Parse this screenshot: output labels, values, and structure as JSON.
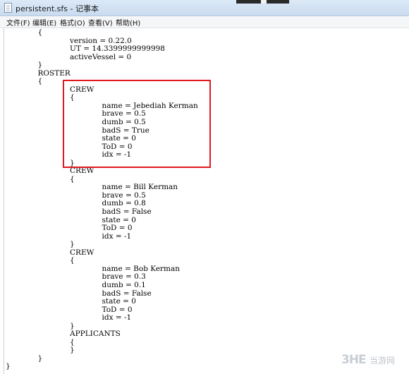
{
  "window": {
    "title": "persistent.sfs - 记事本",
    "icon": "notepad-file-icon"
  },
  "menu": {
    "items": [
      {
        "label": "文件(F)"
      },
      {
        "label": "编辑(E)"
      },
      {
        "label": "格式(O)"
      },
      {
        "label": "查看(V)"
      },
      {
        "label": "帮助(H)"
      }
    ]
  },
  "editor": {
    "lines": [
      "\t{",
      "\t\tversion = 0.22.0",
      "\t\tUT = 14.3399999999998",
      "\t\tactiveVessel = 0",
      "\t}",
      "\tROSTER",
      "\t{",
      "\t\tCREW",
      "\t\t{",
      "\t\t\tname = Jebediah Kerman",
      "\t\t\tbrave = 0.5",
      "\t\t\tdumb = 0.5",
      "\t\t\tbadS = True",
      "\t\t\tstate = 0",
      "\t\t\tToD = 0",
      "\t\t\tidx = -1",
      "\t\t}",
      "\t\tCREW",
      "\t\t{",
      "\t\t\tname = Bill Kerman",
      "\t\t\tbrave = 0.5",
      "\t\t\tdumb = 0.8",
      "\t\t\tbadS = False",
      "\t\t\tstate = 0",
      "\t\t\tToD = 0",
      "\t\t\tidx = -1",
      "\t\t}",
      "\t\tCREW",
      "\t\t{",
      "\t\t\tname = Bob Kerman",
      "\t\t\tbrave = 0.3",
      "\t\t\tdumb = 0.1",
      "\t\t\tbadS = False",
      "\t\t\tstate = 0",
      "\t\t\tToD = 0",
      "\t\t\tidx = -1",
      "\t\t}",
      "\t\tAPPLICANTS",
      "\t\t{",
      "\t\t}",
      "\t}",
      "}"
    ]
  },
  "annotation": {
    "highlight_color": "#e0191e"
  },
  "watermark": {
    "logo": "3HE",
    "text": "当游网"
  }
}
